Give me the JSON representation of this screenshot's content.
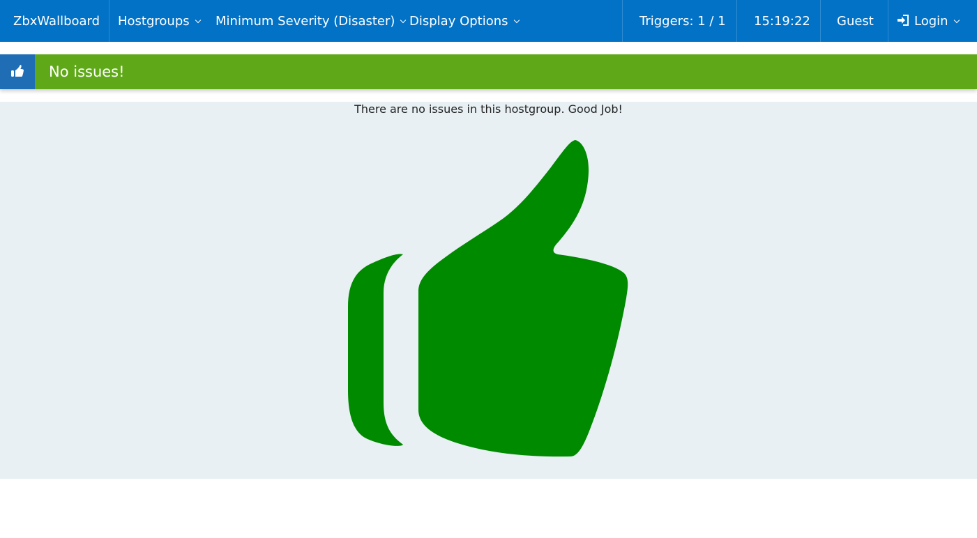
{
  "navbar": {
    "brand": "ZbxWallboard",
    "hostgroups_label": "Hostgroups",
    "severity_label": "Minimum Severity (Disaster)",
    "display_options_label": "Display Options",
    "triggers_label": "Triggers: 1 / 1",
    "clock": "15:19:22",
    "user": "Guest",
    "login_label": "Login",
    "login_icon": "sign-in-icon"
  },
  "alert": {
    "icon": "thumbs-up-icon",
    "text": "No issues!"
  },
  "panel": {
    "message": "There are no issues in this hostgroup. Good Job!",
    "icon": "thumbs-up-icon"
  },
  "colors": {
    "navbar_bg": "#0272c6",
    "alert_bg": "#5fa919",
    "alert_icon_bg": "#1f6db5",
    "panel_bg": "#e8f0f3",
    "thumb_color": "#008a00"
  }
}
